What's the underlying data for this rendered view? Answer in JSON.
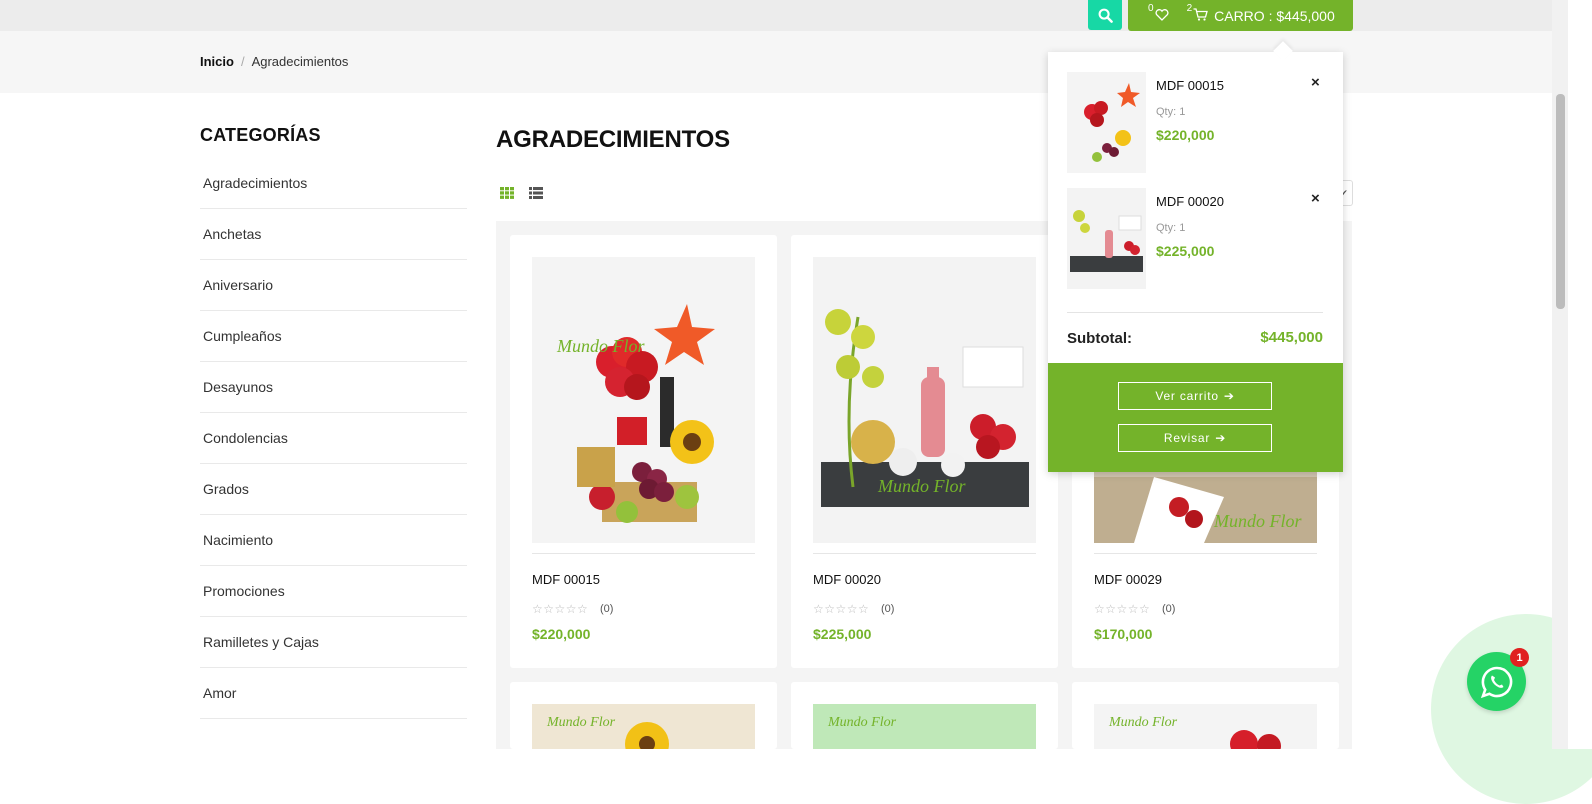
{
  "header": {
    "wishlist_count": "0",
    "cart_count": "2",
    "cart_label": "CARRO : $445,000",
    "colors": {
      "accent": "#74b32a",
      "search": "#17d8a5"
    }
  },
  "breadcrumb": {
    "home": "Inicio",
    "current": "Agradecimientos"
  },
  "sidebar": {
    "title": "CATEGORÍAS",
    "items": [
      {
        "label": "Agradecimientos"
      },
      {
        "label": "Anchetas"
      },
      {
        "label": "Aniversario"
      },
      {
        "label": "Cumpleaños"
      },
      {
        "label": "Desayunos"
      },
      {
        "label": "Condolencias"
      },
      {
        "label": "Grados"
      },
      {
        "label": "Nacimiento"
      },
      {
        "label": "Promociones"
      },
      {
        "label": "Ramilletes y Cajas"
      },
      {
        "label": "Amor"
      }
    ]
  },
  "main": {
    "title": "AGRADECIMIENTOS",
    "view_modes": [
      "grid-icon",
      "list-icon"
    ],
    "products": [
      {
        "name": "MDF 00015",
        "stars": "☆☆☆☆☆",
        "reviews": "(0)",
        "price": "$220,000"
      },
      {
        "name": "MDF 00020",
        "stars": "☆☆☆☆☆",
        "reviews": "(0)",
        "price": "$225,000"
      },
      {
        "name": "MDF 00029",
        "stars": "☆☆☆☆☆",
        "reviews": "(0)",
        "price": "$170,000"
      }
    ]
  },
  "cart_dropdown": {
    "items": [
      {
        "name": "MDF 00015",
        "qty": "Qty: 1",
        "price": "$220,000",
        "remove": "×"
      },
      {
        "name": "MDF 00020",
        "qty": "Qty: 1",
        "price": "$225,000",
        "remove": "×"
      }
    ],
    "subtotal_label": "Subtotal:",
    "subtotal_value": "$445,000",
    "view_cart": "Ver carrito",
    "checkout": "Revisar"
  },
  "whatsapp": {
    "badge": "1"
  }
}
